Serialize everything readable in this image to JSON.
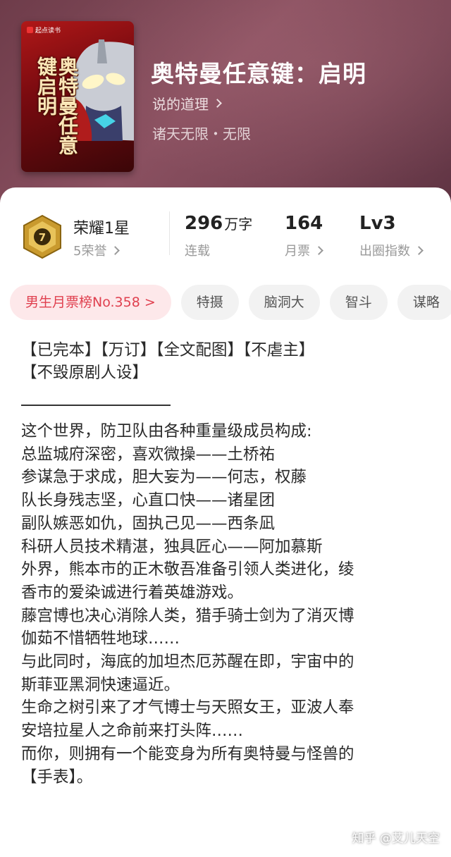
{
  "book": {
    "cover_badge": "起点读书",
    "cover_title": "奥特曼任意键启明",
    "title": "奥特曼任意键：启明",
    "author": "说的道理",
    "genre": "诸天无限・无限"
  },
  "honor": {
    "title": "荣耀1星",
    "sub": "5荣誉"
  },
  "stats": [
    {
      "value": "296",
      "unit": "万字",
      "label": "连载",
      "has_arrow": false
    },
    {
      "value": "164",
      "unit": "",
      "label": "月票",
      "has_arrow": true
    },
    {
      "value": "Lv3",
      "unit": "",
      "label": "出圈指数",
      "has_arrow": true
    }
  ],
  "tags": [
    {
      "label": "男生月票榜No.358 >",
      "rank": true
    },
    {
      "label": "特摄",
      "rank": false
    },
    {
      "label": "脑洞大",
      "rank": false
    },
    {
      "label": "智斗",
      "rank": false
    },
    {
      "label": "谋略",
      "rank": false
    }
  ],
  "desc_head": "【已完本】【万订】【全文配图】【不虐主】\n【不毁原剧人设】",
  "desc_lines": [
    "这个世界，防卫队由各种重量级成员构成:",
    "总监城府深密，喜欢微操——土桥祐",
    "参谋急于求成，胆大妄为——何志，权藤",
    "队长身残志坚，心直口快——诸星团",
    "副队嫉恶如仇，固执己见——西条凪",
    "科研人员技术精湛，独具匠心——阿加慕斯",
    "外界，熊本市的正木敬吾准备引领人类进化，绫",
    "香市的爱染诚进行着英雄游戏。",
    "藤宫博也决心消除人类，猎手骑士剑为了消灭博",
    "伽茹不惜牺牲地球……",
    "与此同时，海底的加坦杰厄苏醒在即，宇宙中的",
    "斯菲亚黑洞快速逼近。",
    "生命之树引来了才气博士与天照女王，亚波人奉",
    "安培拉星人之命前来打头阵……",
    "而你，则拥有一个能变身为所有奥特曼与怪兽的",
    "【手表】。"
  ],
  "watermark": "知乎 @艾儿天空"
}
